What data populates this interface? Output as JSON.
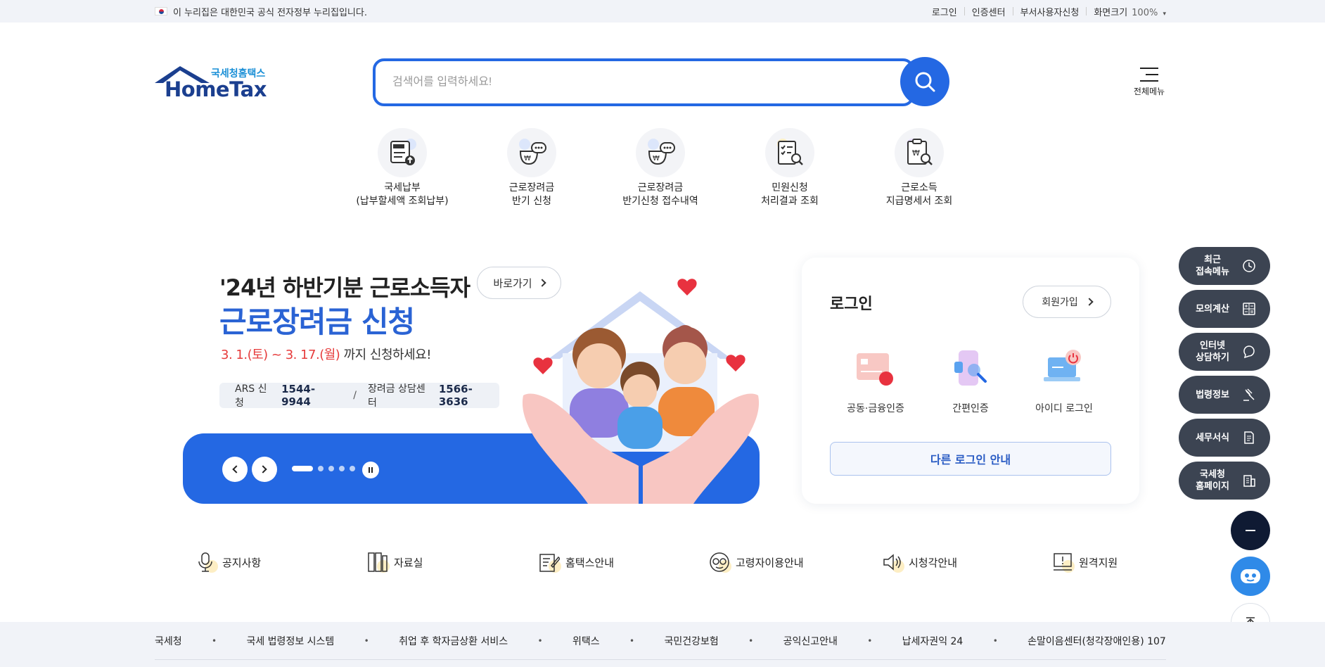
{
  "gov_bar": {
    "notice": "이 누리집은 대한민국 공식 전자정부 누리집입니다.",
    "links": [
      "로그인",
      "인증센터",
      "부서사용자신청",
      "화면크기"
    ],
    "zoom": "100%"
  },
  "logo": {
    "sub": "국세청홈택스",
    "main": "HomeTax"
  },
  "search": {
    "placeholder": "검색어를 입력하세요!"
  },
  "all_menu": {
    "label": "전체메뉴"
  },
  "quick_services": [
    {
      "line1": "국세납부",
      "line2": "(납부할세액 조회납부)",
      "icon": "tax-pay-icon"
    },
    {
      "line1": "근로장려금",
      "line2": "반기 신청",
      "icon": "won-chat-icon"
    },
    {
      "line1": "근로장려금",
      "line2": "반기신청 접수내역",
      "icon": "won-chat-icon"
    },
    {
      "line1": "민원신청",
      "line2": "처리결과 조회",
      "icon": "checklist-search-icon"
    },
    {
      "line1": "근로소득",
      "line2": "지급명세서 조회",
      "icon": "won-document-search-icon"
    }
  ],
  "banner": {
    "title1": "'24년 하반기분 근로소득자",
    "title2": "근로장려금 신청",
    "period_red": "3. 1.(토) ~ 3. 17.(월)",
    "period_rest": " 까지 신청하세요!",
    "shortcut": "바로가기",
    "ars_label": "ARS 신청",
    "ars_number": "1544-9944",
    "slash": "/",
    "center_label": "장려금 상담센터",
    "center_number": "1566-3636",
    "slides_total": 5,
    "active_slide": 1
  },
  "login": {
    "title": "로그인",
    "join": "회원가입",
    "options": [
      "공동·금융인증",
      "간편인증",
      "아이디 로그인"
    ],
    "other": "다른 로그인 안내"
  },
  "side_menu": [
    {
      "l1": "최근",
      "l2": "접속메뉴",
      "icon": "clock-icon"
    },
    {
      "l1": "모의계산",
      "l2": "",
      "icon": "calculator-icon"
    },
    {
      "l1": "인터넷",
      "l2": "상담하기",
      "icon": "chat-icon"
    },
    {
      "l1": "법령정보",
      "l2": "",
      "icon": "gavel-icon"
    },
    {
      "l1": "세무서식",
      "l2": "",
      "icon": "form-icon"
    },
    {
      "l1": "국세청",
      "l2": "홈페이지",
      "icon": "building-icon"
    }
  ],
  "bottom_links": [
    "공지사항",
    "자료실",
    "홈택스안내",
    "고령자이용안내",
    "시청각안내",
    "원격지원"
  ],
  "footer_links": [
    "국세청",
    "국세 법령정보 시스템",
    "취업 후 학자금상환 서비스",
    "위택스",
    "국민건강보험",
    "공익신고안내",
    "납세자권익 24",
    "손말이음센터(청각장애인용) 107"
  ],
  "colors": {
    "primary": "#2468e3",
    "dark_side": "#3c4452",
    "red": "#e63b3b",
    "navy_logo": "#1b3f8f"
  }
}
